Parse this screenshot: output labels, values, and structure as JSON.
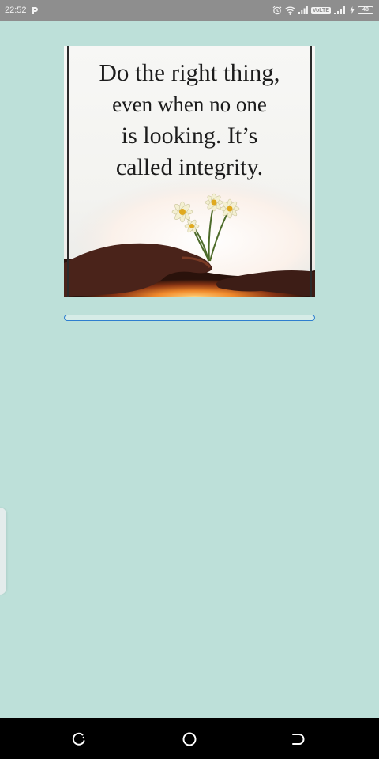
{
  "status_bar": {
    "time": "22:52",
    "notification_icon": "p-icon",
    "icons": [
      "alarm-icon",
      "wifi-icon",
      "signal-icon",
      "lte-signal-icon",
      "battery-icon"
    ],
    "network_badge": "VoLTE",
    "battery_level": "48"
  },
  "quote_image": {
    "lines": [
      "Do the right thing,",
      "even when no one",
      "is looking. It’s",
      "called integrity."
    ]
  },
  "progress": {
    "value": 0
  },
  "nav_bar": {
    "buttons": [
      "recents-button",
      "home-button",
      "back-button"
    ]
  },
  "colors": {
    "background": "#bde0d9",
    "status_bar": "#8e8e8e",
    "progress_accent": "#2f7fcf",
    "nav_bar": "#000000"
  }
}
